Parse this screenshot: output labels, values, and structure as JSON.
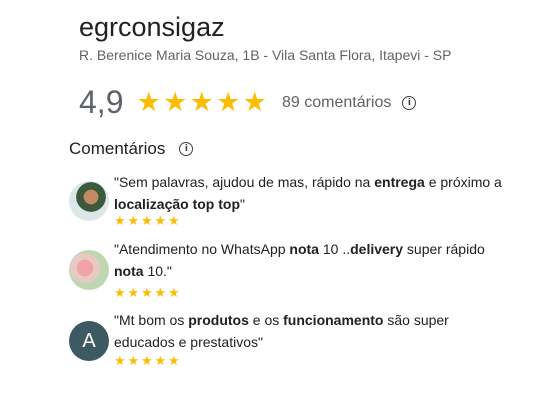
{
  "place": {
    "name": "egrconsigaz",
    "address": "R. Berenice Maria Souza, 1B - Vila Santa Flora, Itapevi - SP",
    "rating": "4,9",
    "rating_stars": 5,
    "reviews_count": "89 comentários"
  },
  "reviews_section": {
    "title": "Comentários"
  },
  "reviews": [
    {
      "avatar": "photo",
      "stars": 5,
      "parts": [
        {
          "t": "\"Sem palavras, ajudou de mas, rápido na ",
          "b": false
        },
        {
          "t": "entrega",
          "b": true
        },
        {
          "t": " e próximo a ",
          "b": false
        },
        {
          "t": "localização top top",
          "b": true
        },
        {
          "t": "\"",
          "b": false
        }
      ]
    },
    {
      "avatar": "photo",
      "stars": 5,
      "parts": [
        {
          "t": "\"Atendimento no WhatsApp ",
          "b": false
        },
        {
          "t": "nota",
          "b": true
        },
        {
          "t": " 10 ..",
          "b": false
        },
        {
          "t": "delivery",
          "b": true
        },
        {
          "t": " super rápido ",
          "b": false
        },
        {
          "t": "nota",
          "b": true
        },
        {
          "t": " 10.\"",
          "b": false
        }
      ]
    },
    {
      "avatar": "letter",
      "avatar_letter": "A",
      "stars": 5,
      "parts": [
        {
          "t": "\"Mt bom os ",
          "b": false
        },
        {
          "t": "produtos",
          "b": true
        },
        {
          "t": " e os ",
          "b": false
        },
        {
          "t": "funcionamento",
          "b": true
        },
        {
          "t": " são super educados e prestativos\"",
          "b": false
        }
      ]
    }
  ],
  "colors": {
    "star": "#fbbc04",
    "avatar_letter_bg": "#3d5a62"
  },
  "icons": {
    "info": "info-icon",
    "star": "star-icon"
  }
}
